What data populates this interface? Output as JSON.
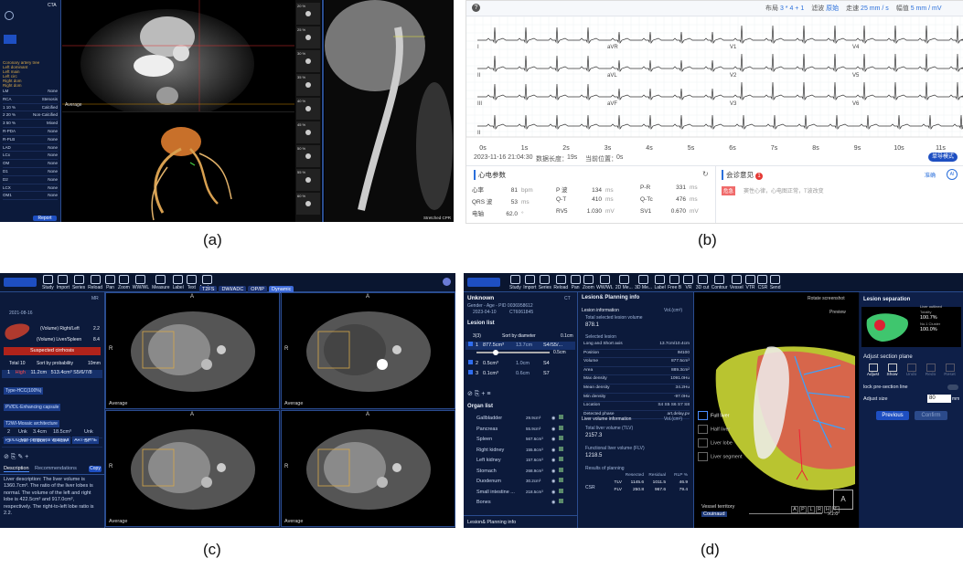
{
  "captions": {
    "a": "(a)",
    "b": "(b)",
    "c": "(c)",
    "d": "(d)"
  },
  "panel_a": {
    "header": "CTA",
    "sidebar_status": [
      "Coronary artery tree",
      "Left dominant",
      "Left main",
      "Left circ",
      "Right dom",
      "Right dom"
    ],
    "sidebar_items": [
      {
        "name": "LM",
        "value": "None"
      },
      {
        "name": "RCA",
        "value": "Stenosis"
      },
      {
        "name": "1  10 %",
        "value": "Calcified"
      },
      {
        "name": "2  20 %",
        "value": "Non-Calcified"
      },
      {
        "name": "3  50 %",
        "value": "Mixed"
      },
      {
        "name": "R-PDA",
        "value": "None"
      },
      {
        "name": "R-PLB",
        "value": "None"
      },
      {
        "name": "LAD",
        "value": "None"
      },
      {
        "name": "LCx",
        "value": "None"
      },
      {
        "name": "OM",
        "value": "None"
      },
      {
        "name": "D1",
        "value": "None"
      },
      {
        "name": "D2",
        "value": "None"
      },
      {
        "name": "LCX",
        "value": "None"
      },
      {
        "name": "OM1",
        "value": "None"
      }
    ],
    "report_button": "Report",
    "average_label": "Average",
    "curved_label": "Stretched CPR",
    "side_percentages": [
      "20 %",
      "25 %",
      "30 %",
      "35 %",
      "40 %",
      "45 %",
      "50 %",
      "55 %",
      "60 %"
    ]
  },
  "panel_b": {
    "help": "?",
    "layout_label": "布局",
    "layout_value": "3 * 4 + 1",
    "filter_label": "滤波",
    "filter_value": "原始",
    "speed_label": "走速",
    "speed_value": "25 mm / s",
    "gain_label": "幅值",
    "gain_value": "5 mm / mV",
    "leads": [
      "I",
      "II",
      "III",
      "aVR",
      "aVL",
      "aVF",
      "V1",
      "V2",
      "V3",
      "V4",
      "V5",
      "V6",
      "II"
    ],
    "time_ticks": [
      "0s",
      "1s",
      "2s",
      "3s",
      "4s",
      "5s",
      "6s",
      "7s",
      "8s",
      "9s",
      "10s",
      "11s"
    ],
    "timestamp": "2023-11-16 21:04:30",
    "length_label": "数据长度：",
    "length_value": "19s",
    "position_label": "当前位置：",
    "position_value": "0s",
    "mode_button": "单导模式",
    "params_title": "心电参数",
    "params": [
      {
        "k": "心率",
        "v": "81",
        "u": "bpm"
      },
      {
        "k": "P 波",
        "v": "134",
        "u": "ms"
      },
      {
        "k": "P-R",
        "v": "331",
        "u": "ms"
      },
      {
        "k": "QRS 波",
        "v": "53",
        "u": "ms"
      },
      {
        "k": "Q-T",
        "v": "410",
        "u": "ms"
      },
      {
        "k": "Q-Tc",
        "v": "476",
        "u": "ms"
      },
      {
        "k": "电轴",
        "v": "62.0",
        "u": "°"
      },
      {
        "k": "RV5",
        "v": "1.030",
        "u": "mV"
      },
      {
        "k": "SV1",
        "v": "0.670",
        "u": "mV"
      }
    ],
    "opinion_title": "会诊意见",
    "opinion_badge": "1",
    "opinion_link": "准确",
    "opinion_ai": "AI",
    "opinion_tag": "危急",
    "opinion_text": "窦性心律，心电图正常，T波改变"
  },
  "panel_c": {
    "toolbar": [
      "Study",
      "Import",
      "Series",
      "Reload",
      "Pan",
      "Zoom",
      "WW/WL",
      "Measure",
      "Label",
      "Text",
      "Analyse"
    ],
    "sequence_tabs": [
      "T2FS",
      "DWI/ADC",
      "OP/IP",
      "Dynamic"
    ],
    "patient_id": "MR",
    "date": "2021-08-16",
    "volume_ratio_label": "(Volume) Right/Left",
    "volume_ratio_value": "2.2",
    "volume_liver_spleen_label": "(Volume) Liver/Spleen",
    "volume_liver_spleen_value": "8.4",
    "alert": "Suspected cirrhosis",
    "total_label": "Total 10",
    "sort_label": "Sort by probability",
    "size_filter": "10mm",
    "lesion_main": {
      "idx": "1",
      "risk": "High",
      "size": "11.2cm",
      "volume": "513.4cm³",
      "segments": "S5/6/7/8"
    },
    "tags": [
      "Type-HCC(100%)",
      "PV/DL-Enhancing capsule",
      "T2WI-Mosaic architecture",
      "PV/DL-Non-peripheral washout",
      "ART-APHE"
    ],
    "lesions": [
      {
        "idx": "2",
        "risk": "Unk",
        "size": "3.4cm",
        "volume": "18.5cm³",
        "seg": "Unk"
      },
      {
        "idx": "3",
        "risk": "Unk",
        "size": "0.8cm",
        "volume": "0.4cm³",
        "seg": "S7"
      }
    ],
    "tab_description": "Description",
    "tab_recommendations": "Recommendations",
    "copy_button": "Copy",
    "description": "Liver description: The liver volume is 1360.7cm³. The ratio of the liver lobes is normal. The volume of the left and right lobe is 422.5cm³ and 917.0cm³, respectively. The right-to-left lobe ratio is 2.2.",
    "viewport_labels": {
      "top": "A",
      "left": "R",
      "wl": "Average"
    }
  },
  "panel_d": {
    "toolbar": [
      "Study",
      "Import",
      "Series",
      "Reload",
      "Pan",
      "Zoom",
      "WW/WL",
      "2D Me...",
      "3D Me...",
      "Label",
      "Free B",
      "VR",
      "3D cut",
      "Contour",
      "Vessel",
      "VTR",
      "CSR",
      "Send"
    ],
    "patient_name": "Unknown",
    "patient_meta": "Gender -  Age -  PID 0036958612",
    "date": "2023-04-10",
    "series": "CT6061845",
    "modality": "CT",
    "lesion_list_title": "Lesion list",
    "sort_label": "Sort by diameter",
    "count": "3(3)",
    "size_filter": "0.1cm",
    "lesions": [
      {
        "idx": "1",
        "vol": "877.5cm³",
        "diam": "13.7cm",
        "seg": "S4/S5/..."
      },
      {
        "idx": "2",
        "vol": "0.5cm³",
        "diam": "1.0cm",
        "seg": "S4"
      },
      {
        "idx": "3",
        "vol": "0.1cm³",
        "diam": "0.6cm",
        "seg": "S7"
      }
    ],
    "slider_value": "0.5cm",
    "organ_list_title": "Organ list",
    "organs": [
      {
        "name": "Gallbladder",
        "vol": "29.9cm³"
      },
      {
        "name": "Pancreas",
        "vol": "55.9cm³"
      },
      {
        "name": "Spleen",
        "vol": "567.6cm³"
      },
      {
        "name": "Right kidney",
        "vol": "155.8cm³"
      },
      {
        "name": "Left kidney",
        "vol": "157.6cm³"
      },
      {
        "name": "Stomach",
        "vol": "268.9cm³"
      },
      {
        "name": "Duodenum",
        "vol": "30.2cm³"
      },
      {
        "name": "Small intestine ...",
        "vol": "218.5cm³"
      },
      {
        "name": "Bones",
        "vol": ""
      }
    ],
    "footer_title": "Lesion& Planning info",
    "info_title": "Lesion& Planning info",
    "lesion_info_title": "Lesion information",
    "vol_unit": "Vol.(cm³)",
    "total_lesion_label": "Total selected lesion volume",
    "total_lesion_value": "878.1",
    "selected_label": "Selected lesion",
    "props": [
      {
        "k": "Long and Short axis",
        "v": "13.7cm/10.4cm"
      },
      {
        "k": "Position",
        "v": "IM100"
      },
      {
        "k": "Volume",
        "v": "877.5cm³"
      },
      {
        "k": "Area",
        "v": "889.3cm²"
      },
      {
        "k": "Max density",
        "v": "1091.0Hu"
      },
      {
        "k": "Mean density",
        "v": "34.2Hu"
      },
      {
        "k": "Min density",
        "v": "-97.0Hu"
      },
      {
        "k": "Location",
        "v": "S4 S5 S6 S7 S8"
      },
      {
        "k": "Detected phase",
        "v": "art,delay,pv"
      }
    ],
    "liver_volume_title": "Liver volume information",
    "tlv_label": "Total liver volume (TLV)",
    "tlv_value": "2157.3",
    "flv_label": "Functional liver volume (FLV)",
    "flv_value": "1218.5",
    "results_title": "Results of planning",
    "table_headers": [
      "Resected",
      "Residual",
      "RLP %"
    ],
    "table_group": "CSR",
    "table_rows": [
      {
        "label": "TLV",
        "cells": [
          "1145.6",
          "1011.5",
          "46.9"
        ]
      },
      {
        "label": "FLV",
        "cells": [
          "250.8",
          "967.6",
          "79.4"
        ]
      }
    ],
    "rotate_label": "Rotate screenshot",
    "preview_label": "Preview",
    "segment_options": [
      "Full liver",
      "Half liver",
      "Liver lobe",
      "Liver segment"
    ],
    "vessel_territory_label": "Vessel territory",
    "vessel_territory_value": "Couinaud",
    "zoom": "X1.0",
    "orientation_buttons": [
      "A",
      "P",
      "L",
      "R",
      "H",
      "F"
    ],
    "cube_label": "A",
    "sep_title": "Lesion separation",
    "sep_stats_title": "Liver outlined",
    "sep_stats": [
      "Totality",
      "100.7%",
      "No.1 Cluster",
      "100.0%"
    ],
    "adjust_title": "Adjust section plane",
    "adjust_tools": [
      "Adjust",
      "Show",
      "Undo",
      "Redo",
      "Reset"
    ],
    "lock_label": "lock pre-section line",
    "size_label": "Adjust size",
    "size_value": "80",
    "size_unit": "mm",
    "prev_button": "Previous",
    "confirm_button": "Confirm"
  }
}
